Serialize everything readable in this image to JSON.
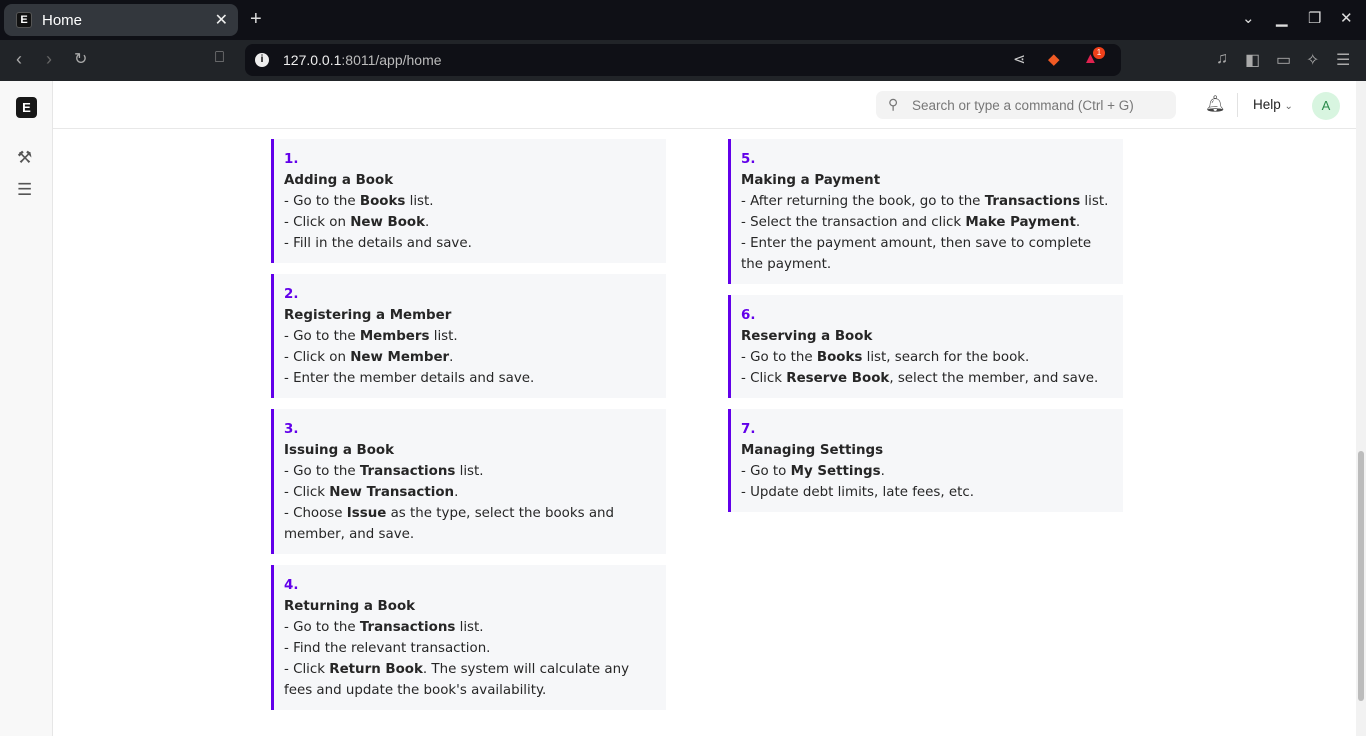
{
  "browser": {
    "tab_title": "Home",
    "url_host": "127.0.0.1",
    "url_rest": ":8011/app/home",
    "notification_count": "1"
  },
  "header": {
    "search_placeholder": "Search or type a command (Ctrl + G)",
    "help_label": "Help",
    "avatar_initial": "A"
  },
  "accent": "#6200ea",
  "cards": [
    {
      "num": "1.",
      "title": "Adding a Book",
      "lines": [
        [
          {
            "t": "- Go to the "
          },
          {
            "t": "Books",
            "b": true
          },
          {
            "t": " list."
          }
        ],
        [
          {
            "t": "- Click on "
          },
          {
            "t": "New Book",
            "b": true
          },
          {
            "t": "."
          }
        ],
        [
          {
            "t": "- Fill in the details and save."
          }
        ]
      ]
    },
    {
      "num": "2.",
      "title": "Registering a Member",
      "lines": [
        [
          {
            "t": "- Go to the "
          },
          {
            "t": "Members",
            "b": true
          },
          {
            "t": " list."
          }
        ],
        [
          {
            "t": "- Click on "
          },
          {
            "t": "New Member",
            "b": true
          },
          {
            "t": "."
          }
        ],
        [
          {
            "t": "- Enter the member details and save."
          }
        ]
      ]
    },
    {
      "num": "3.",
      "title": "Issuing a Book",
      "lines": [
        [
          {
            "t": "- Go to the "
          },
          {
            "t": "Transactions",
            "b": true
          },
          {
            "t": " list."
          }
        ],
        [
          {
            "t": "- Click "
          },
          {
            "t": "New Transaction",
            "b": true
          },
          {
            "t": "."
          }
        ],
        [
          {
            "t": "- Choose "
          },
          {
            "t": "Issue",
            "b": true
          },
          {
            "t": " as the type, select the books and member, and save."
          }
        ]
      ]
    },
    {
      "num": "4.",
      "title": "Returning a Book",
      "lines": [
        [
          {
            "t": "- Go to the "
          },
          {
            "t": "Transactions",
            "b": true
          },
          {
            "t": " list."
          }
        ],
        [
          {
            "t": "- Find the relevant transaction."
          }
        ],
        [
          {
            "t": "- Click "
          },
          {
            "t": "Return Book",
            "b": true
          },
          {
            "t": ". The system will calculate any fees and update the book's availability."
          }
        ]
      ]
    },
    {
      "num": "5.",
      "title": "Making a Payment",
      "lines": [
        [
          {
            "t": "- After returning the book, go to the "
          },
          {
            "t": "Transactions",
            "b": true
          },
          {
            "t": " list."
          }
        ],
        [
          {
            "t": "- Select the transaction and click "
          },
          {
            "t": "Make Payment",
            "b": true
          },
          {
            "t": "."
          }
        ],
        [
          {
            "t": "- Enter the payment amount, then save to complete the payment."
          }
        ]
      ]
    },
    {
      "num": "6.",
      "title": "Reserving a Book",
      "lines": [
        [
          {
            "t": "- Go to the "
          },
          {
            "t": "Books",
            "b": true
          },
          {
            "t": " list, search for the book."
          }
        ],
        [
          {
            "t": "- Click "
          },
          {
            "t": "Reserve Book",
            "b": true
          },
          {
            "t": ", select the member, and save."
          }
        ]
      ]
    },
    {
      "num": "7.",
      "title": "Managing Settings",
      "lines": [
        [
          {
            "t": "- Go to "
          },
          {
            "t": "My Settings",
            "b": true
          },
          {
            "t": "."
          }
        ],
        [
          {
            "t": "- Update debt limits, late fees, etc."
          }
        ]
      ]
    }
  ]
}
